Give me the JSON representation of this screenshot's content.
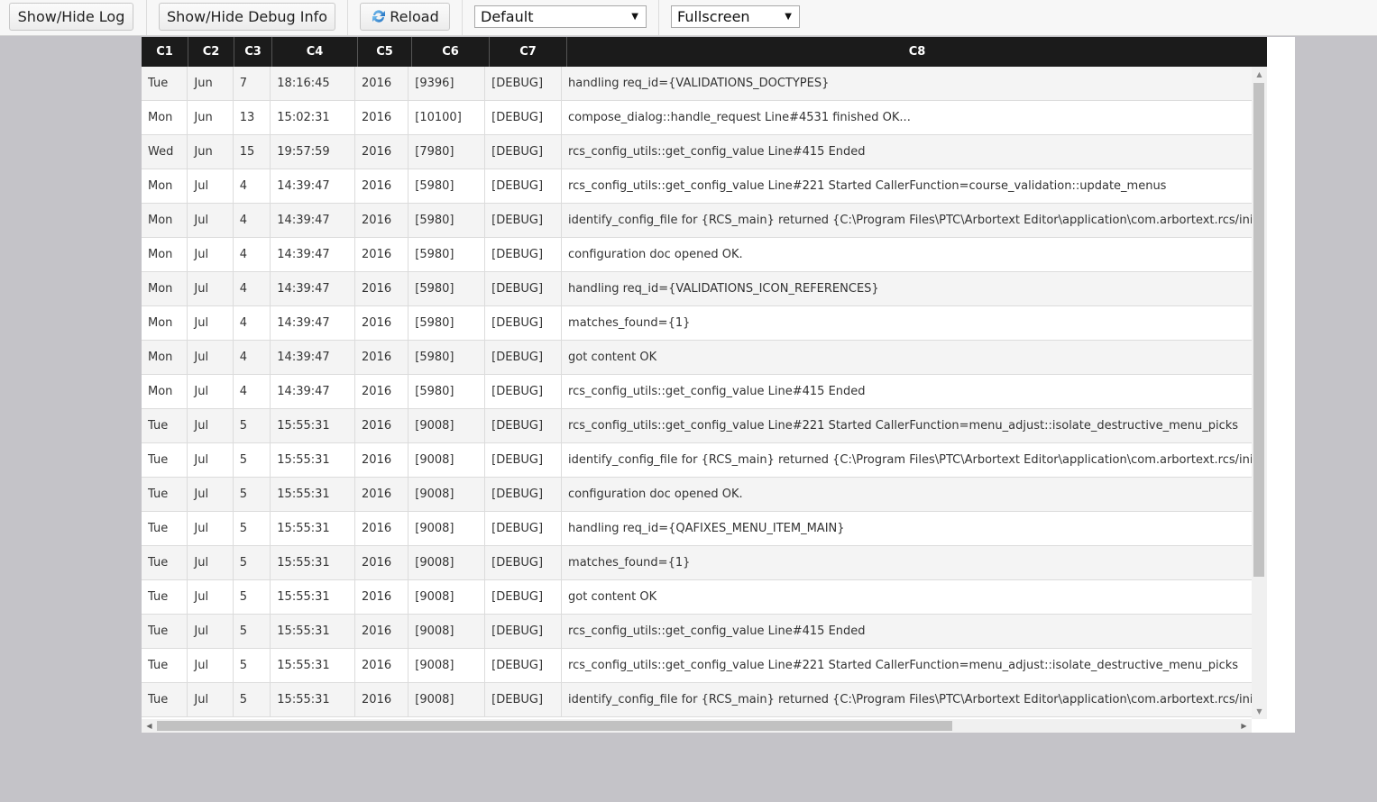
{
  "toolbar": {
    "show_hide_log": "Show/Hide Log",
    "show_hide_debug": "Show/Hide Debug Info",
    "reload": "Reload",
    "reload_icon": "refresh-icon",
    "theme_select": {
      "selected": "Default"
    },
    "view_select": {
      "selected": "Fullscreen"
    }
  },
  "table": {
    "columns": [
      "C1",
      "C2",
      "C3",
      "C4",
      "C5",
      "C6",
      "C7",
      "C8"
    ],
    "rows": [
      [
        "Tue",
        "Jun",
        "7",
        "18:16:45",
        "2016",
        "[9396]",
        "[DEBUG]",
        "handling req_id={VALIDATIONS_DOCTYPES}"
      ],
      [
        "Mon",
        "Jun",
        "13",
        "15:02:31",
        "2016",
        "[10100]",
        "[DEBUG]",
        "compose_dialog::handle_request Line#4531 finished OK..."
      ],
      [
        "Wed",
        "Jun",
        "15",
        "19:57:59",
        "2016",
        "[7980]",
        "[DEBUG]",
        "rcs_config_utils::get_config_value Line#415 Ended"
      ],
      [
        "Mon",
        "Jul",
        "4",
        "14:39:47",
        "2016",
        "[5980]",
        "[DEBUG]",
        "rcs_config_utils::get_config_value Line#221 Started CallerFunction=course_validation::update_menus"
      ],
      [
        "Mon",
        "Jul",
        "4",
        "14:39:47",
        "2016",
        "[5980]",
        "[DEBUG]",
        "identify_config_file for {RCS_main} returned {C:\\Program Files\\PTC\\Arbortext Editor\\application\\com.arbortext.rcs/init/config_"
      ],
      [
        "Mon",
        "Jul",
        "4",
        "14:39:47",
        "2016",
        "[5980]",
        "[DEBUG]",
        "configuration doc opened OK."
      ],
      [
        "Mon",
        "Jul",
        "4",
        "14:39:47",
        "2016",
        "[5980]",
        "[DEBUG]",
        "handling req_id={VALIDATIONS_ICON_REFERENCES}"
      ],
      [
        "Mon",
        "Jul",
        "4",
        "14:39:47",
        "2016",
        "[5980]",
        "[DEBUG]",
        "matches_found={1}"
      ],
      [
        "Mon",
        "Jul",
        "4",
        "14:39:47",
        "2016",
        "[5980]",
        "[DEBUG]",
        "got content OK"
      ],
      [
        "Mon",
        "Jul",
        "4",
        "14:39:47",
        "2016",
        "[5980]",
        "[DEBUG]",
        "rcs_config_utils::get_config_value Line#415 Ended"
      ],
      [
        "Tue",
        "Jul",
        "5",
        "15:55:31",
        "2016",
        "[9008]",
        "[DEBUG]",
        "rcs_config_utils::get_config_value Line#221 Started CallerFunction=menu_adjust::isolate_destructive_menu_picks"
      ],
      [
        "Tue",
        "Jul",
        "5",
        "15:55:31",
        "2016",
        "[9008]",
        "[DEBUG]",
        "identify_config_file for {RCS_main} returned {C:\\Program Files\\PTC\\Arbortext Editor\\application\\com.arbortext.rcs/init/config_"
      ],
      [
        "Tue",
        "Jul",
        "5",
        "15:55:31",
        "2016",
        "[9008]",
        "[DEBUG]",
        "configuration doc opened OK."
      ],
      [
        "Tue",
        "Jul",
        "5",
        "15:55:31",
        "2016",
        "[9008]",
        "[DEBUG]",
        "handling req_id={QAFIXES_MENU_ITEM_MAIN}"
      ],
      [
        "Tue",
        "Jul",
        "5",
        "15:55:31",
        "2016",
        "[9008]",
        "[DEBUG]",
        "matches_found={1}"
      ],
      [
        "Tue",
        "Jul",
        "5",
        "15:55:31",
        "2016",
        "[9008]",
        "[DEBUG]",
        "got content OK"
      ],
      [
        "Tue",
        "Jul",
        "5",
        "15:55:31",
        "2016",
        "[9008]",
        "[DEBUG]",
        "rcs_config_utils::get_config_value Line#415 Ended"
      ],
      [
        "Tue",
        "Jul",
        "5",
        "15:55:31",
        "2016",
        "[9008]",
        "[DEBUG]",
        "rcs_config_utils::get_config_value Line#221 Started CallerFunction=menu_adjust::isolate_destructive_menu_picks"
      ],
      [
        "Tue",
        "Jul",
        "5",
        "15:55:31",
        "2016",
        "[9008]",
        "[DEBUG]",
        "identify_config_file for {RCS_main} returned {C:\\Program Files\\PTC\\Arbortext Editor\\application\\com.arbortext.rcs/init/config_"
      ]
    ]
  },
  "colors": {
    "header_bg": "#1b1b1b",
    "page_bg": "#c4c3c8",
    "row_alt": "#f4f4f4"
  }
}
